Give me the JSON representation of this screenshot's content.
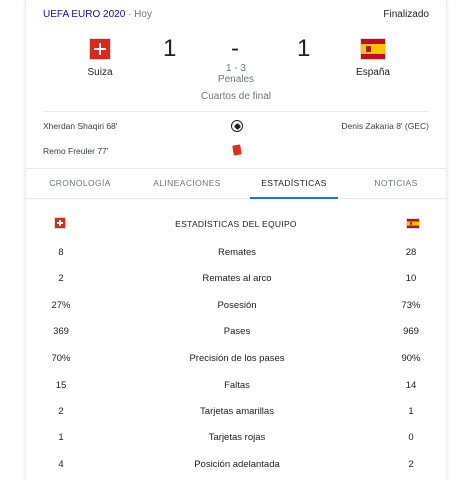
{
  "header": {
    "competition": "UEFA EURO 2020",
    "separator": "·",
    "date": "Hoy",
    "status": "Finalizado"
  },
  "match": {
    "home": {
      "name": "Suiza",
      "flag_icon": "switzerland-flag-icon",
      "score": "1"
    },
    "away": {
      "name": "España",
      "flag_icon": "spain-flag-icon",
      "score": "1"
    },
    "dash": "-",
    "penalties_score": "1 - 3",
    "penalties_label": "Penales",
    "round": "Cuartos de final"
  },
  "events": {
    "goals_home": "Xherdan Shaqiri 68'",
    "goals_away": "Denis Zakaria 8' (GEC)",
    "goal_icon": "soccer-ball-icon",
    "red_home": "Remo Freuler 77'",
    "red_icon": "red-card-icon"
  },
  "tabs": [
    {
      "label": "CRONOLOGÍA",
      "active": false
    },
    {
      "label": "ALINEACIONES",
      "active": false
    },
    {
      "label": "ESTADÍSTICAS",
      "active": true
    },
    {
      "label": "NOTICIAS",
      "active": false
    }
  ],
  "stats": {
    "title": "ESTADÍSTICAS DEL EQUIPO",
    "rows": [
      {
        "home": "8",
        "label": "Remates",
        "away": "28"
      },
      {
        "home": "2",
        "label": "Remates al arco",
        "away": "10"
      },
      {
        "home": "27%",
        "label": "Posesión",
        "away": "73%"
      },
      {
        "home": "369",
        "label": "Pases",
        "away": "969"
      },
      {
        "home": "70%",
        "label": "Precisión de los pases",
        "away": "90%"
      },
      {
        "home": "15",
        "label": "Faltas",
        "away": "14"
      },
      {
        "home": "2",
        "label": "Tarjetas amarillas",
        "away": "1"
      },
      {
        "home": "1",
        "label": "Tarjetas rojas",
        "away": "0"
      },
      {
        "home": "4",
        "label": "Posición adelantada",
        "away": "2"
      }
    ]
  },
  "colors": {
    "link": "#1a0dab",
    "active_tab_underline": "#1a73e8",
    "muted_text": "#70757a",
    "red_card": "#d93025"
  }
}
